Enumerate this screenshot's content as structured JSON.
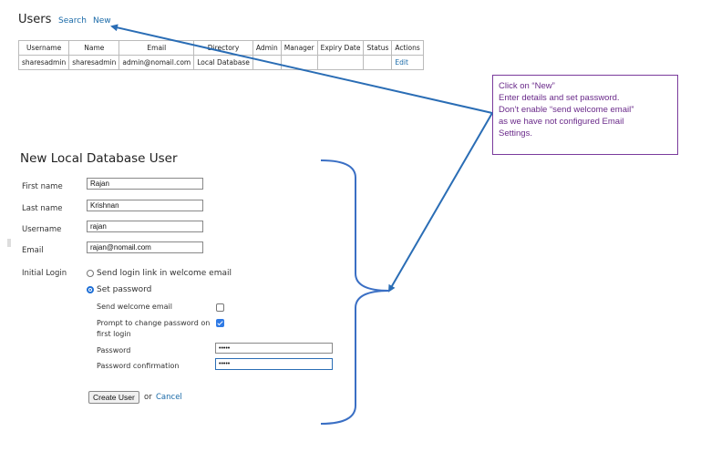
{
  "header": {
    "title": "Users",
    "search_label": "Search",
    "new_label": "New"
  },
  "users_table": {
    "columns": [
      "Username",
      "Name",
      "Email",
      "Directory",
      "Admin",
      "Manager",
      "Expiry Date",
      "Status",
      "Actions"
    ],
    "rows": [
      {
        "username": "sharesadmin",
        "name": "sharesadmin",
        "email": "admin@nomail.com",
        "directory": "Local Database",
        "admin": "",
        "manager": "",
        "expiry_date": "",
        "status": "",
        "action": "Edit"
      }
    ]
  },
  "callout": {
    "lines": [
      "Click on “New”",
      "Enter details and set password.",
      "Don’t enable “send welcome email”",
      "as we have not configured Email",
      "Settings."
    ],
    "color": "#7a3b9c"
  },
  "annotation": {
    "arrow_color": "#2a6db5",
    "brace_color": "#3a6fc4"
  },
  "form": {
    "title": "New Local Database User",
    "first_name": {
      "label": "First name",
      "value": "Rajan"
    },
    "last_name": {
      "label": "Last name",
      "value": "Krishnan"
    },
    "username": {
      "label": "Username",
      "value": "rajan"
    },
    "email": {
      "label": "Email",
      "value": "rajan@nomail.com"
    },
    "initial_login": {
      "label": "Initial Login",
      "option_link": "Send login link in welcome email",
      "option_password": "Set password",
      "selected": "Set password"
    },
    "send_welcome_email": {
      "label": "Send welcome email",
      "checked": false
    },
    "prompt_change": {
      "label_line1": "Prompt to change password on",
      "label_line2": "first login",
      "checked": true
    },
    "password": {
      "label": "Password",
      "value": "•••••"
    },
    "password_confirm": {
      "label": "Password confirmation",
      "value": "•••••"
    },
    "create_button": "Create User",
    "or_text": "or",
    "cancel_label": "Cancel"
  }
}
